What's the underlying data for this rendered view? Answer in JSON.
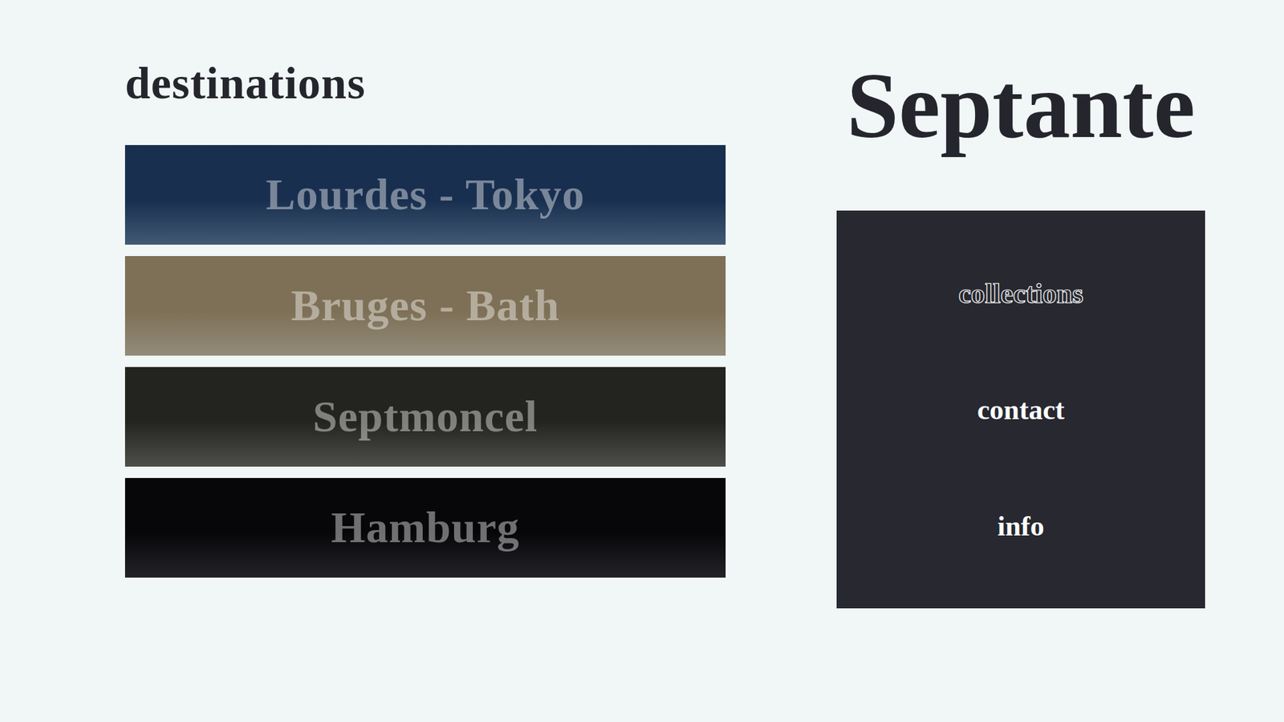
{
  "page": {
    "heading": "destinations"
  },
  "destinations": [
    {
      "label": "Lourdes - Tokyo",
      "color": "#4f6d8e"
    },
    {
      "label": "Bruges - Bath",
      "color": "#b3a994"
    },
    {
      "label": "Septmoncel",
      "color": "#5f605a"
    },
    {
      "label": "Hamburg",
      "color": "#2b2a31"
    }
  ],
  "brand": {
    "title": "Septante"
  },
  "menu": {
    "items": [
      {
        "label": "collections",
        "selected": true
      },
      {
        "label": "contact",
        "selected": false
      },
      {
        "label": "info",
        "selected": false
      }
    ]
  }
}
